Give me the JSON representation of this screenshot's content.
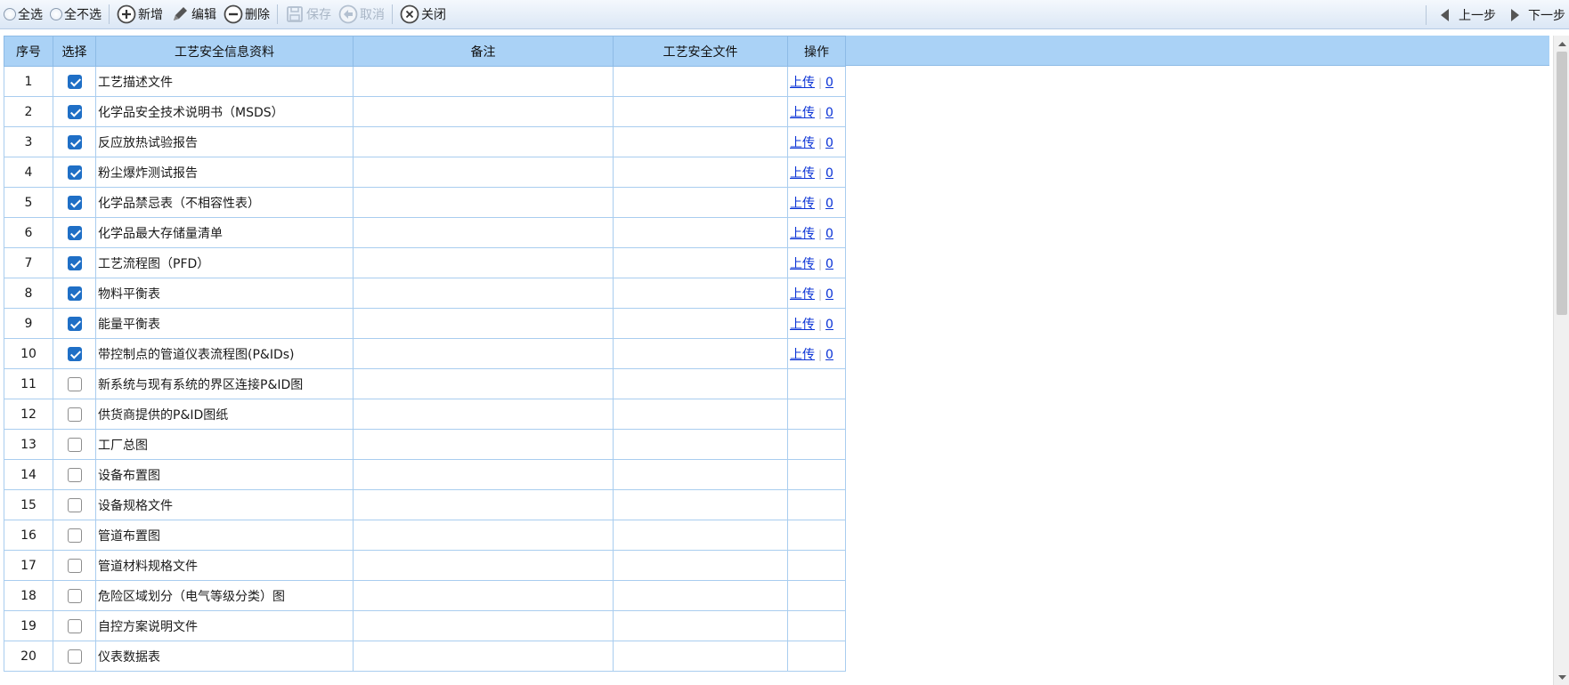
{
  "toolbar": {
    "select_all": "全选",
    "select_none": "全不选",
    "add": "新增",
    "edit": "编辑",
    "delete": "删除",
    "save": "保存",
    "cancel": "取消",
    "close": "关闭",
    "prev": "上一步",
    "next": "下一步"
  },
  "table": {
    "headers": {
      "no": "序号",
      "select": "选择",
      "name": "工艺安全信息资料",
      "note": "备注",
      "file": "工艺安全文件",
      "op": "操作"
    },
    "upload_label": "上传",
    "op_separator": "|",
    "rows": [
      {
        "no": "1",
        "checked": true,
        "name": "工艺描述文件",
        "count": "0"
      },
      {
        "no": "2",
        "checked": true,
        "name": "化学品安全技术说明书（MSDS）",
        "count": "0"
      },
      {
        "no": "3",
        "checked": true,
        "name": "反应放热试验报告",
        "count": "0"
      },
      {
        "no": "4",
        "checked": true,
        "name": "粉尘爆炸测试报告",
        "count": "0"
      },
      {
        "no": "5",
        "checked": true,
        "name": "化学品禁忌表（不相容性表）",
        "count": "0"
      },
      {
        "no": "6",
        "checked": true,
        "name": "化学品最大存储量清单",
        "count": "0"
      },
      {
        "no": "7",
        "checked": true,
        "name": "工艺流程图（PFD）",
        "count": "0"
      },
      {
        "no": "8",
        "checked": true,
        "name": "物料平衡表",
        "count": "0"
      },
      {
        "no": "9",
        "checked": true,
        "name": "能量平衡表",
        "count": "0"
      },
      {
        "no": "10",
        "checked": true,
        "name": "带控制点的管道仪表流程图(P&IDs)",
        "count": "0"
      },
      {
        "no": "11",
        "checked": false,
        "name": "新系统与现有系统的界区连接P&ID图",
        "count": ""
      },
      {
        "no": "12",
        "checked": false,
        "name": "供货商提供的P&ID图纸",
        "count": ""
      },
      {
        "no": "13",
        "checked": false,
        "name": "工厂总图",
        "count": ""
      },
      {
        "no": "14",
        "checked": false,
        "name": "设备布置图",
        "count": ""
      },
      {
        "no": "15",
        "checked": false,
        "name": "设备规格文件",
        "count": ""
      },
      {
        "no": "16",
        "checked": false,
        "name": "管道布置图",
        "count": ""
      },
      {
        "no": "17",
        "checked": false,
        "name": "管道材料规格文件",
        "count": ""
      },
      {
        "no": "18",
        "checked": false,
        "name": "危险区域划分（电气等级分类）图",
        "count": ""
      },
      {
        "no": "19",
        "checked": false,
        "name": "自控方案说明文件",
        "count": ""
      },
      {
        "no": "20",
        "checked": false,
        "name": "仪表数据表",
        "count": ""
      }
    ]
  },
  "colors": {
    "header_bg": "#aad2f6",
    "grid_line": "#a9cdef",
    "checkbox_checked": "#1f6fc6",
    "link": "#0b33d6"
  }
}
